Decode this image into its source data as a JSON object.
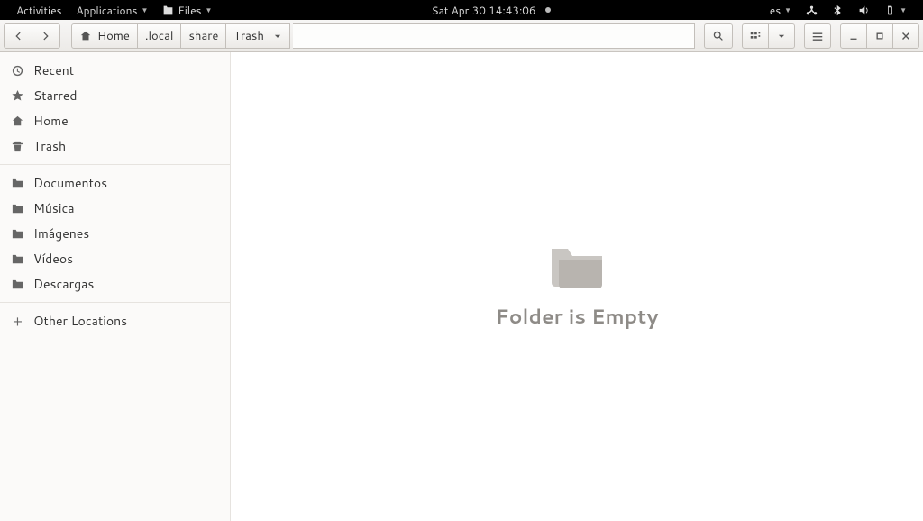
{
  "panel": {
    "activities": "Activities",
    "applications": "Applications",
    "app_name": "Files",
    "clock": "Sat Apr 30  14:43:06",
    "input_source": "es"
  },
  "toolbar": {
    "crumbs": [
      "Home",
      ".local",
      "share",
      "Trash"
    ]
  },
  "sidebar": {
    "quick": [
      {
        "icon": "recent",
        "label": "Recent"
      },
      {
        "icon": "star",
        "label": "Starred"
      },
      {
        "icon": "home",
        "label": "Home"
      },
      {
        "icon": "trash",
        "label": "Trash"
      }
    ],
    "folders": [
      {
        "label": "Documentos"
      },
      {
        "label": "Música"
      },
      {
        "label": "Imágenes"
      },
      {
        "label": "Vídeos"
      },
      {
        "label": "Descargas"
      }
    ],
    "other": "Other Locations"
  },
  "content": {
    "empty_label": "Folder is Empty"
  }
}
